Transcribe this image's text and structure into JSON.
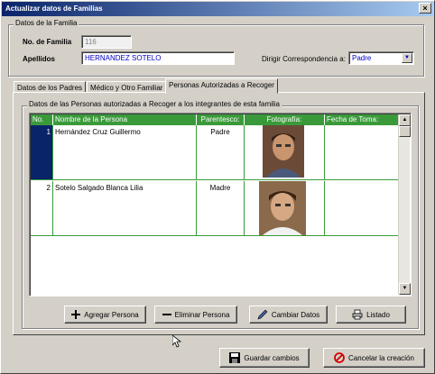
{
  "window": {
    "title": "Actualizar datos de Familias",
    "close_glyph": "×"
  },
  "family": {
    "legend": "Datos de la Familia",
    "number_label": "No. de Familia",
    "number_value": "116",
    "surname_label": "Apellidos",
    "surname_value": "HERNANDEZ SOTELO",
    "correspondence_label": "Dirigir Correspondencia a:",
    "correspondence_value": "Padre"
  },
  "tabs": [
    {
      "label": "Datos de los Padres"
    },
    {
      "label": "Médico y Otro Familiar"
    },
    {
      "label": "Personas Autorizadas a Recoger"
    }
  ],
  "authorized": {
    "legend": "Datos de las Personas autorizadas a Recoger a los integrantes de esta familia",
    "columns": [
      "No.",
      "Nombre de la Persona",
      "Parentesco:",
      "Fotografía:",
      "Fecha de Toma:"
    ],
    "rows": [
      {
        "no": "1",
        "name": "Hernández Cruz Guillermo",
        "relation": "Padre",
        "date": ""
      },
      {
        "no": "2",
        "name": "Sotelo Salgado Blanca Lilia",
        "relation": "Madre",
        "date": ""
      }
    ]
  },
  "actions": {
    "add": "Agregar Persona",
    "delete": "Eliminar Persona",
    "change": "Cambiar Datos",
    "list": "Listado"
  },
  "footer": {
    "save": "Guardar cambios",
    "cancel": "Cancelar la creación"
  },
  "colors": {
    "grid_header": "#3a9a3a",
    "selected_row": "#0a246a"
  }
}
